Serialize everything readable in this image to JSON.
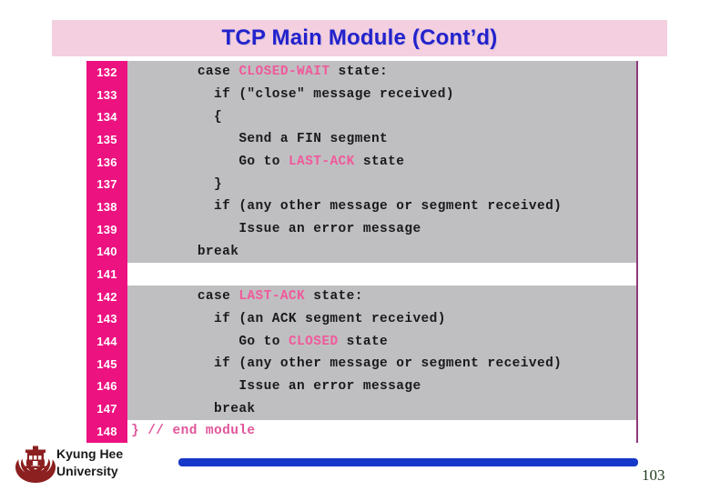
{
  "slide": {
    "title": "TCP Main Module (Cont’d)",
    "title_bg": "#F3CFDF",
    "title_color": "#2222CC",
    "page_number": "103"
  },
  "code": {
    "gutter_bg": "#EC1280",
    "gutter_text_color": "#FFFFFF",
    "code_bg": "#BFBFC2",
    "code_text_color": "#1A1A1A",
    "keyword_color": "#F05A9B",
    "border_color": "#8E3A7A",
    "lines": [
      {
        "num": "132",
        "indent": 8,
        "blank": false,
        "parts": [
          {
            "t": "case ",
            "k": false
          },
          {
            "t": "CLOSED-WAIT",
            "k": true
          },
          {
            "t": " state:",
            "k": false
          }
        ]
      },
      {
        "num": "133",
        "indent": 10,
        "blank": false,
        "parts": [
          {
            "t": "if (\"close\" message received)",
            "k": false
          }
        ]
      },
      {
        "num": "134",
        "indent": 10,
        "blank": false,
        "parts": [
          {
            "t": "{",
            "k": false
          }
        ]
      },
      {
        "num": "135",
        "indent": 13,
        "blank": false,
        "parts": [
          {
            "t": "Send a FIN segment",
            "k": false
          }
        ]
      },
      {
        "num": "136",
        "indent": 13,
        "blank": false,
        "parts": [
          {
            "t": "Go to ",
            "k": false
          },
          {
            "t": "LAST-ACK",
            "k": true
          },
          {
            "t": " state",
            "k": false
          }
        ]
      },
      {
        "num": "137",
        "indent": 10,
        "blank": false,
        "parts": [
          {
            "t": "}",
            "k": false
          }
        ]
      },
      {
        "num": "138",
        "indent": 10,
        "blank": false,
        "parts": [
          {
            "t": "if (any other message or segment received)",
            "k": false
          }
        ]
      },
      {
        "num": "139",
        "indent": 13,
        "blank": false,
        "parts": [
          {
            "t": "Issue an error message",
            "k": false
          }
        ]
      },
      {
        "num": "140",
        "indent": 8,
        "blank": false,
        "parts": [
          {
            "t": "break",
            "k": false
          }
        ]
      },
      {
        "num": "141",
        "indent": 0,
        "blank": true,
        "parts": [
          {
            "t": "",
            "k": false
          }
        ]
      },
      {
        "num": "142",
        "indent": 8,
        "blank": false,
        "parts": [
          {
            "t": "case ",
            "k": false
          },
          {
            "t": "LAST-ACK",
            "k": true
          },
          {
            "t": " state:",
            "k": false
          }
        ]
      },
      {
        "num": "143",
        "indent": 10,
        "blank": false,
        "parts": [
          {
            "t": "if (an ACK segment received)",
            "k": false
          }
        ]
      },
      {
        "num": "144",
        "indent": 13,
        "blank": false,
        "parts": [
          {
            "t": "Go to ",
            "k": false
          },
          {
            "t": "CLOSED",
            "k": true
          },
          {
            "t": " state",
            "k": false
          }
        ]
      },
      {
        "num": "145",
        "indent": 10,
        "blank": false,
        "parts": [
          {
            "t": "if (any other message or segment received)",
            "k": false
          }
        ]
      },
      {
        "num": "146",
        "indent": 13,
        "blank": false,
        "parts": [
          {
            "t": "Issue an error message",
            "k": false
          }
        ]
      },
      {
        "num": "147",
        "indent": 10,
        "blank": false,
        "parts": [
          {
            "t": "break",
            "k": false
          }
        ]
      },
      {
        "num": "148",
        "indent": 0,
        "blank": true,
        "comment": true,
        "parts": [
          {
            "t": "} // end module",
            "k": false
          }
        ]
      }
    ]
  },
  "footer": {
    "university_line1": "Kyung Hee",
    "university_line2": "University",
    "logo_name": "kyung-hee-university-crest",
    "logo_color": "#8C1F1F",
    "bar_color": "#1638C8"
  }
}
